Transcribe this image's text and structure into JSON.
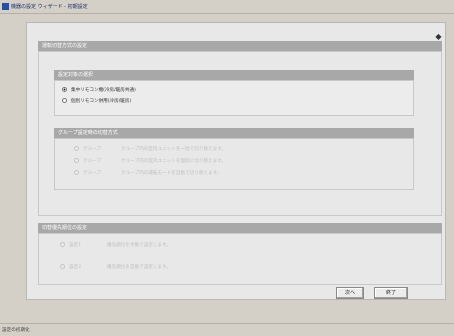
{
  "window": {
    "title": "機器の設定 ウィザード - 初期設定",
    "status_text": "設定の初期化"
  },
  "main_section": {
    "title": "運転切替方式の設定"
  },
  "sub1": {
    "title": "設定対象の選択",
    "options": [
      {
        "label": "集中リモコン機(冷房/暖房共通)",
        "checked": true,
        "enabled": true
      },
      {
        "label": "個別リモコン併用(冷房/暖房)",
        "checked": false,
        "enabled": true
      }
    ]
  },
  "sub2": {
    "title": "グループ設定時の切替方式",
    "options": [
      {
        "prefix": "グループ",
        "label": "グループ内の室内ユニットを一括で切り替えます。",
        "enabled": false
      },
      {
        "prefix": "グループ",
        "label": "グループ内の室内ユニットを個別に切り替えます。",
        "enabled": false
      },
      {
        "prefix": "グループ",
        "label": "グループ内の運転モードを自動で切り替えます。",
        "enabled": false
      }
    ]
  },
  "sec3": {
    "title": "切替優先順位の設定",
    "options": [
      {
        "prefix": "設定1",
        "label": "優先順位を手動で設定します。",
        "enabled": false
      },
      {
        "prefix": "設定2",
        "label": "優先順位を自動で設定します。",
        "enabled": false
      }
    ]
  },
  "buttons": {
    "next_label": "次へ",
    "finish_label": "終了"
  },
  "colors": {
    "section_header": "#a8a8a8",
    "panel": "#e8e8e8",
    "window": "#d4d0c8"
  }
}
